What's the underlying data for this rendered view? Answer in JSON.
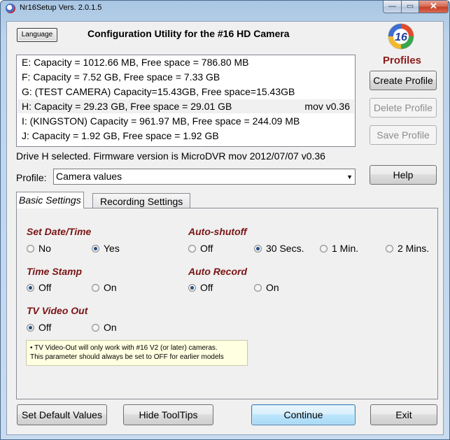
{
  "window": {
    "title": "Nr16Setup  Vers. 2.0.1.5",
    "controls": {
      "minimize": "—",
      "maximize": "▭",
      "close": "✕"
    }
  },
  "header": {
    "language_button": "Language",
    "title": "Configuration Utility for the #16 HD Camera",
    "logo_text": "16",
    "profiles_label": "Profiles"
  },
  "drives": [
    {
      "label": "E:  Capacity = 1012.66 MB, Free space = 786.80 MB",
      "extra": ""
    },
    {
      "label": "F:  Capacity = 7.52 GB, Free space = 7.33 GB",
      "extra": ""
    },
    {
      "label": "G: (TEST CAMERA) Capacity=15.43GB, Free space=15.43GB",
      "extra": ""
    },
    {
      "label": "H:  Capacity = 29.23 GB, Free space = 29.01 GB",
      "extra": "mov v0.36"
    },
    {
      "label": "I: (KINGSTON) Capacity = 961.97 MB, Free space = 244.09 MB",
      "extra": ""
    },
    {
      "label": "J:  Capacity = 1.92 GB, Free space = 1.92 GB",
      "extra": ""
    }
  ],
  "profile_buttons": {
    "create": "Create Profile",
    "delete": "Delete Profile",
    "save": "Save Profile",
    "help": "Help"
  },
  "status": "Drive H selected. Firmware version is MicroDVR mov 2012/07/07 v0.36",
  "profile": {
    "label": "Profile:",
    "selected": "Camera values",
    "arrow": "▼"
  },
  "tabs": {
    "basic": "Basic Settings",
    "recording": "Recording Settings"
  },
  "settings": {
    "set_date_time": {
      "title": "Set Date/Time",
      "options": [
        "No",
        "Yes"
      ],
      "selected": "Yes"
    },
    "auto_shutoff": {
      "title": "Auto-shutoff",
      "options": [
        "Off",
        "30 Secs.",
        "1 Min.",
        "2 Mins."
      ],
      "selected": "30 Secs."
    },
    "time_stamp": {
      "title": "Time Stamp",
      "options": [
        "Off",
        "On"
      ],
      "selected": "Off"
    },
    "auto_record": {
      "title": "Auto Record",
      "options": [
        "Off",
        "On"
      ],
      "selected": "Off"
    },
    "tv_video_out": {
      "title": "TV Video Out",
      "options": [
        "Off",
        "On"
      ],
      "selected": "Off"
    }
  },
  "tooltip": {
    "line1": "• TV Video-Out will only work with #16 V2 (or later) cameras.",
    "line2": "  This parameter should always be set to OFF for earlier models"
  },
  "footer": {
    "set_default": "Set Default Values",
    "hide_tooltips": "Hide ToolTips",
    "continue": "Continue",
    "exit": "Exit"
  },
  "colors": {
    "section_title": "#7a1414",
    "profiles_label": "#8b1a1a"
  }
}
